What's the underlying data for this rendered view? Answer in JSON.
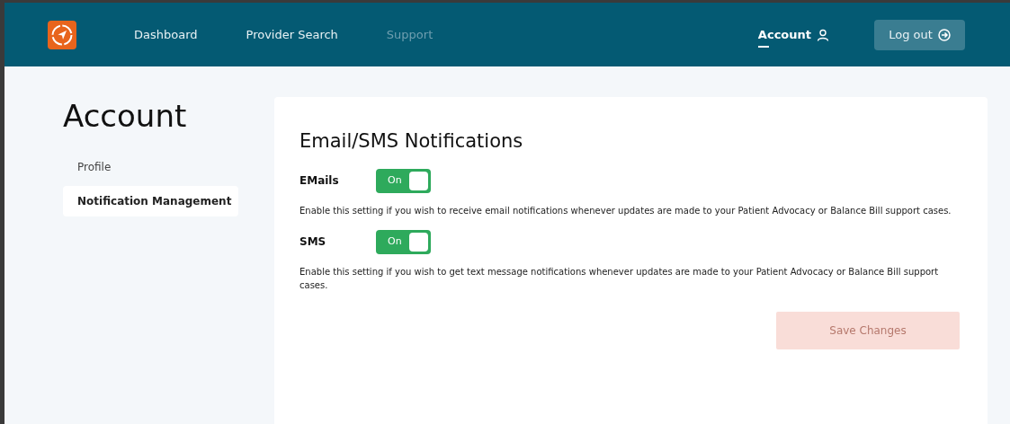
{
  "nav": {
    "items": [
      {
        "label": "Dashboard",
        "selected": false,
        "disabled": false
      },
      {
        "label": "Provider Search",
        "selected": false,
        "disabled": false
      },
      {
        "label": "Support",
        "selected": false,
        "disabled": true
      }
    ],
    "account": {
      "label": "Account",
      "selected": true
    },
    "logout": {
      "label": "Log out"
    }
  },
  "page_title": "Account",
  "sidebar": {
    "items": [
      {
        "label": "Profile",
        "selected": false
      },
      {
        "label": "Notification Management",
        "selected": true
      }
    ]
  },
  "panel": {
    "title": "Email/SMS Notifications",
    "settings": [
      {
        "label": "EMails",
        "toggle_label": "On",
        "on": true,
        "description": "Enable this setting if you wish to receive email notifications whenever updates are made to your Patient Advocacy or Balance Bill support cases."
      },
      {
        "label": "SMS",
        "toggle_label": "On",
        "on": true,
        "description": "Enable this setting if you wish to get text message notifications whenever updates are made to your Patient Advocacy or Balance Bill support cases."
      }
    ],
    "save_button": {
      "label": "Save Changes",
      "disabled": true
    }
  }
}
